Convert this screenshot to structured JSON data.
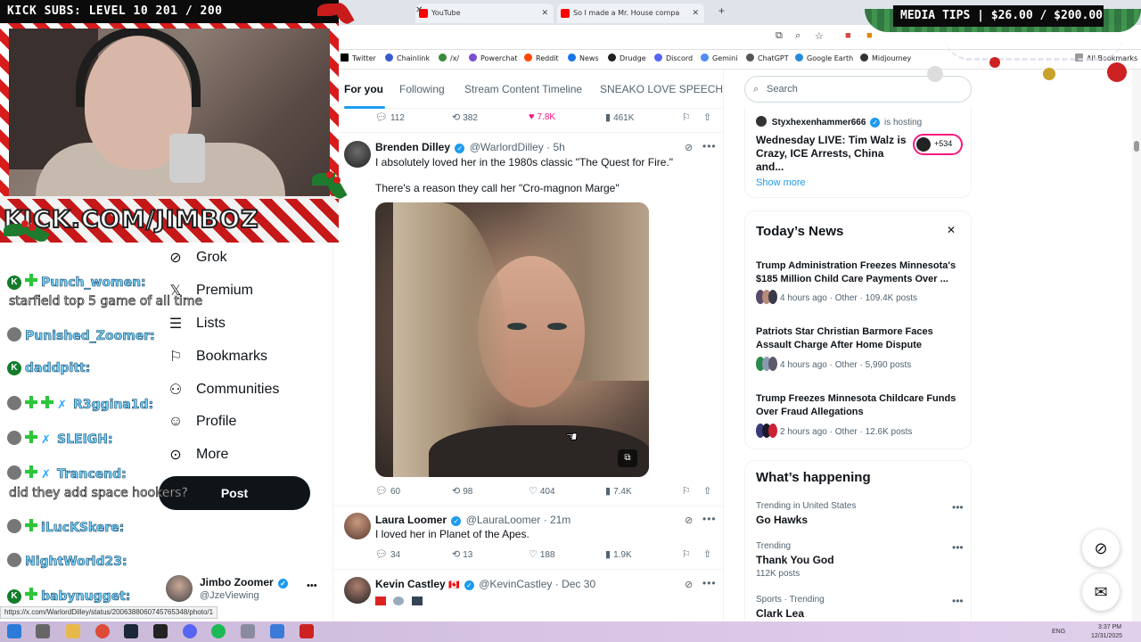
{
  "overlay": {
    "kick_subs": "KICK SUBS: LEVEL 10 201 / 200",
    "media_tips": "MEDIA TIPS | $26.00 / $200.00",
    "kick_url": "KICK.COM/JIMBOZ"
  },
  "browser": {
    "tabs": [
      {
        "title": "YouTube"
      },
      {
        "title": "So I made a Mr. House compa"
      }
    ],
    "bookmarks": [
      "Twitter",
      "Chainlink",
      "/x/",
      "Powerchat",
      "Reddit",
      "News",
      "Drudge",
      "Discord",
      "Gemini",
      "ChatGPT",
      "Google Earth",
      "Midjourney"
    ],
    "all_bookmarks": "All Bookmarks",
    "status_url": "https://x.com/WarlordDilley/status/2006388060745765348/photo/1"
  },
  "chat": [
    {
      "user": "Punch_women:",
      "message": "starfield top 5 game of all time"
    },
    {
      "user": "Punished_Zoomer:"
    },
    {
      "user": "daddpitt:"
    },
    {
      "user": "R3ggina1d:"
    },
    {
      "user": "SLEIGH:"
    },
    {
      "user": "Trancend:",
      "message": "did they add space hookers?"
    },
    {
      "user": "iLucKSkere:"
    },
    {
      "user": "NightWorld23:"
    },
    {
      "user": "babynugget:"
    }
  ],
  "nav": {
    "items": [
      {
        "label": "Grok",
        "icon": "grok-icon"
      },
      {
        "label": "Premium",
        "icon": "x-logo-icon"
      },
      {
        "label": "Lists",
        "icon": "list-icon"
      },
      {
        "label": "Bookmarks",
        "icon": "bookmark-icon"
      },
      {
        "label": "Communities",
        "icon": "communities-icon"
      },
      {
        "label": "Profile",
        "icon": "profile-icon"
      },
      {
        "label": "More",
        "icon": "more-icon"
      }
    ],
    "post": "Post",
    "account_name": "Jimbo Zoomer",
    "account_handle": "@JzeViewing"
  },
  "timeline": {
    "tabs": [
      "For you",
      "Following",
      "Stream Content Timeline",
      "SNEAKO LOVE SPEECH"
    ],
    "top_actions": {
      "replies": "112",
      "reposts": "382",
      "likes": "7.8K",
      "views": "461K"
    },
    "tweets": [
      {
        "name": "Brenden Dilley",
        "handle": "@WarlordDilley",
        "time": "5h",
        "text1": "I absolutely loved her in the 1980s classic \"The Quest for Fire.\"",
        "text2": "There's a reason they call her \"Cro-magnon Marge\"",
        "replies": "60",
        "reposts": "98",
        "likes": "404",
        "views": "7.4K"
      },
      {
        "name": "Laura Loomer",
        "handle": "@LauraLoomer",
        "time": "21m",
        "text1": "I loved her in Planet of the Apes.",
        "replies": "34",
        "reposts": "13",
        "likes": "188",
        "views": "1.9K"
      },
      {
        "name": "Kevin Castley",
        "flag": "🇨🇦",
        "handle": "@KevinCastley",
        "time": "Dec 30"
      }
    ]
  },
  "sidebar": {
    "search_placeholder": "Search",
    "live": {
      "host": "Styxhexenhammer666",
      "hosting": "is hosting",
      "title": "Wednesday LIVE: Tim Walz is Crazy, ICE Arrests, China and...",
      "count": "+534",
      "show_more": "Show more"
    },
    "news": {
      "title": "Today’s News",
      "items": [
        {
          "headline": "Trump Administration Freezes Minnesota's $185 Million Child Care Payments Over ...",
          "meta": "4 hours ago · Other · 109.4K posts"
        },
        {
          "headline": "Patriots Star Christian Barmore Faces Assault Charge After Home Dispute",
          "meta": "4 hours ago · Other · 5,990 posts"
        },
        {
          "headline": "Trump Freezes Minnesota Childcare Funds Over Fraud Allegations",
          "meta": "2 hours ago · Other · 12.6K posts"
        }
      ]
    },
    "happening": {
      "title": "What’s happening",
      "trends": [
        {
          "context": "Trending in United States",
          "name": "Go Hawks",
          "sub": ""
        },
        {
          "context": "Trending",
          "name": "Thank You God",
          "sub": "112K posts"
        },
        {
          "context": "Sports · Trending",
          "name": "Clark Lea",
          "sub": ""
        }
      ]
    }
  },
  "taskbar": {
    "lang": "ENG",
    "time": "3:37 PM",
    "date": "12/31/2025"
  },
  "colors": {
    "x_blue": "#1d9bf0",
    "like_pink": "#f91880",
    "candy_red": "#d81c1c"
  }
}
